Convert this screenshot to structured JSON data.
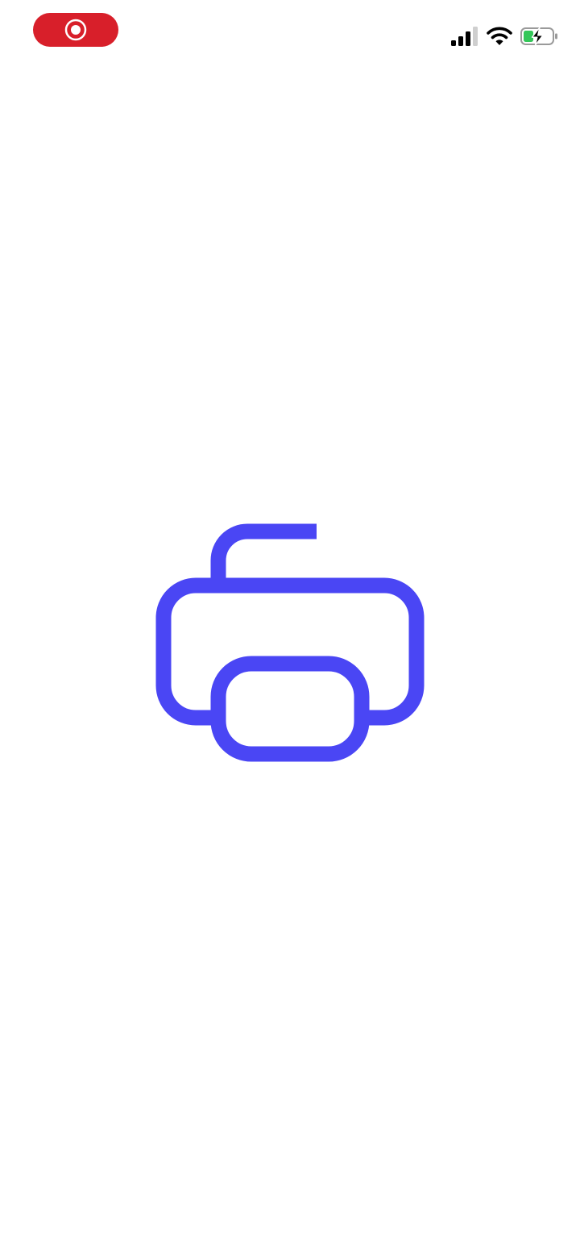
{
  "status_bar": {
    "recording_indicator": {
      "icon": "screen-recording-icon",
      "color": "#d81f2a"
    },
    "signal": {
      "icon": "cellular-signal-icon",
      "bars_active": 3,
      "bars_total": 4
    },
    "wifi": {
      "icon": "wifi-icon"
    },
    "battery": {
      "icon": "battery-charging-icon",
      "charging": true,
      "accent_color": "#34c759"
    }
  },
  "splash": {
    "logo": {
      "icon": "printer-logo-icon",
      "color": "#4a46f4"
    }
  },
  "colors": {
    "background": "#ffffff",
    "brand": "#4a46f4",
    "recording": "#d81f2a",
    "battery_charge": "#34c759"
  }
}
